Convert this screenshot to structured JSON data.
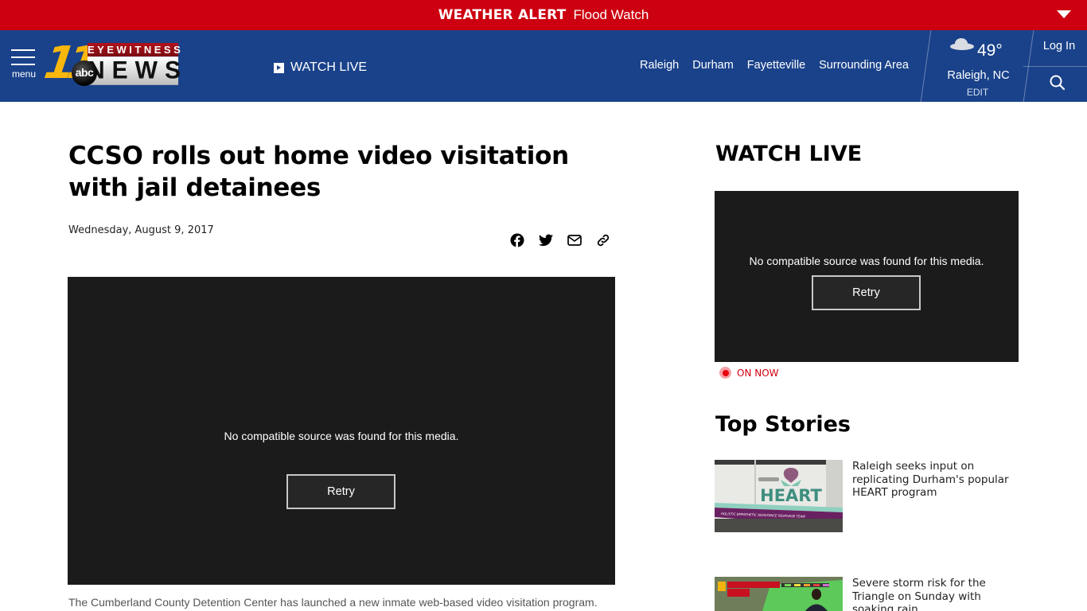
{
  "alert": {
    "title": "WEATHER ALERT",
    "text": "Flood Watch"
  },
  "header": {
    "menu_label": "menu",
    "logo": {
      "number": "11",
      "top_text": "EYEWITNESS",
      "bottom_text": "NEWS",
      "network": "abc"
    },
    "watch_live_label": "WATCH LIVE",
    "nav": [
      {
        "label": "Raleigh"
      },
      {
        "label": "Durham"
      },
      {
        "label": "Fayetteville"
      },
      {
        "label": "Surrounding Area"
      }
    ],
    "weather": {
      "icon": "cloud-icon",
      "temperature": "49°",
      "location": "Raleigh, NC",
      "edit_label": "EDIT"
    },
    "login_label": "Log In"
  },
  "article": {
    "headline": "CCSO rolls out home video visitation with jail detainees",
    "date": "Wednesday, August 9, 2017",
    "share": [
      "facebook-icon",
      "twitter-icon",
      "email-icon",
      "link-icon"
    ],
    "player": {
      "message": "No compatible source was found for this media.",
      "retry_label": "Retry"
    },
    "caption": "The Cumberland County Detention Center has launched a new inmate web-based video visitation program."
  },
  "sidebar": {
    "watch_live": {
      "title": "WATCH LIVE",
      "message": "No compatible source was found for this media.",
      "retry_label": "Retry",
      "status": "ON NOW"
    },
    "top_stories": {
      "title": "Top Stories",
      "items": [
        {
          "title": "Raleigh seeks input on replicating Durham's popular HEART program"
        },
        {
          "title": "Severe storm risk for the Triangle on Sunday with soaking rain"
        }
      ]
    }
  },
  "colors": {
    "alert_red": "#cc0010",
    "header_blue": "#1a428a",
    "on_now_red": "#d10010",
    "player_bg": "#1b1b1b"
  }
}
